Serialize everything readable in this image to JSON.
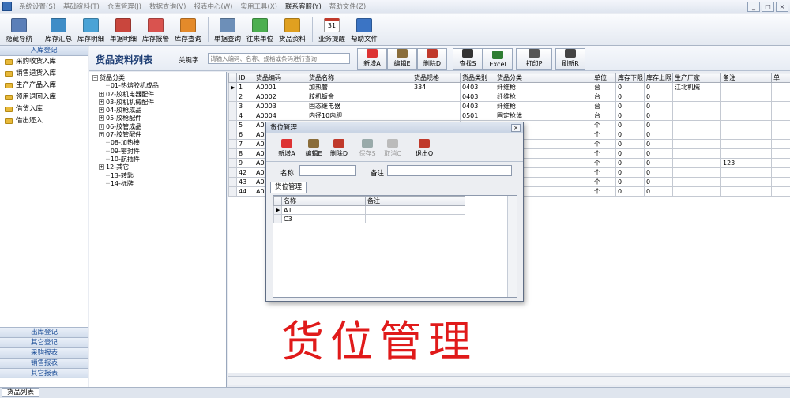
{
  "menu": [
    "系统设置(S)",
    "基础资料(T)",
    "仓库管理(J)",
    "数据查询(V)",
    "报表中心(W)",
    "实用工具(X)",
    "联系客服(Y)",
    "帮助文件(Z)"
  ],
  "window_buttons": [
    "_",
    "□",
    "×"
  ],
  "toolbar": [
    "隐藏导航",
    "库存汇总",
    "库存明细",
    "单据明细",
    "库存报警",
    "库存查询",
    "单据查询",
    "往来单位",
    "货品资料",
    "业务提醒",
    "帮助文件"
  ],
  "calendar_day": "31",
  "left_nav": {
    "header": "入库登记",
    "items": [
      "采购收货入库",
      "销售退货入库",
      "生产产品入库",
      "领用退回入库",
      "借货入库",
      "借出还入"
    ],
    "bottom": [
      "出库登记",
      "其它登记",
      "采购报表",
      "销售报表",
      "其它报表"
    ]
  },
  "page": {
    "title": "货品资料列表",
    "keyword_label": "关键字",
    "keyword_placeholder": "请输入编码、名称、规格或条码进行查询"
  },
  "actions": [
    "新增A",
    "编辑E",
    "删除D",
    "查找S",
    "Excel",
    "打印P",
    "刷新R"
  ],
  "tree": {
    "root": "货品分类",
    "nodes": [
      {
        "label": "01-热熔胶机成品",
        "expand": false
      },
      {
        "label": "02-胶机电器配件",
        "expand": true
      },
      {
        "label": "03-胶机机械配件",
        "expand": true
      },
      {
        "label": "04-胶枪成品",
        "expand": true
      },
      {
        "label": "05-胶枪配件",
        "expand": true
      },
      {
        "label": "06-胶管成品",
        "expand": true
      },
      {
        "label": "07-胶管配件",
        "expand": true
      },
      {
        "label": "08-加热棒",
        "expand": false
      },
      {
        "label": "09-密封件",
        "expand": false
      },
      {
        "label": "10-航插件",
        "expand": false
      },
      {
        "label": "12-其它",
        "expand": true
      },
      {
        "label": "13-转匙",
        "expand": false
      },
      {
        "label": "14-标牌",
        "expand": false
      }
    ]
  },
  "grid": {
    "columns": [
      "ID",
      "货品编码",
      "货品名称",
      "货品规格",
      "货品类别",
      "货品分类",
      "单位",
      "库存下限",
      "库存上限",
      "生产厂家",
      "备注",
      "单"
    ],
    "rows": [
      [
        "1",
        "A0001",
        "加热管",
        "334",
        "0403",
        "纤维枪",
        "台",
        "0",
        "0",
        "江北机械",
        ""
      ],
      [
        "2",
        "A0002",
        "胶机钣金",
        "",
        "0403",
        "纤维枪",
        "台",
        "0",
        "0",
        "",
        ""
      ],
      [
        "3",
        "A0003",
        "固态继电器",
        "",
        "0403",
        "纤维枪",
        "台",
        "0",
        "0",
        "",
        ""
      ],
      [
        "4",
        "A0004",
        "内径10内胆",
        "",
        "0501",
        "固定枪体",
        "台",
        "0",
        "0",
        "",
        ""
      ],
      [
        "5",
        "A0",
        "",
        "",
        "",
        "",
        "个",
        "0",
        "0",
        "",
        ""
      ],
      [
        "6",
        "A0",
        "",
        "",
        "",
        "",
        "个",
        "0",
        "0",
        "",
        ""
      ],
      [
        "7",
        "A0",
        "",
        "",
        "",
        "",
        "个",
        "0",
        "0",
        "",
        ""
      ],
      [
        "8",
        "A0",
        "",
        "",
        "",
        "",
        "个",
        "0",
        "0",
        "",
        ""
      ],
      [
        "9",
        "A0",
        "",
        "",
        "",
        "",
        "个",
        "0",
        "0",
        "",
        "123"
      ],
      [
        "42",
        "A0",
        "",
        "",
        "",
        "",
        "个",
        "0",
        "0",
        "",
        ""
      ],
      [
        "43",
        "A0",
        "",
        "",
        "",
        "",
        "个",
        "0",
        "0",
        "",
        ""
      ],
      [
        "44",
        "A0",
        "",
        "",
        "",
        "",
        "个",
        "0",
        "0",
        "",
        ""
      ]
    ]
  },
  "status_tab": "货品列表",
  "dialog": {
    "title": "货位管理",
    "close": "×",
    "buttons": [
      {
        "label": "新增A",
        "enabled": true
      },
      {
        "label": "编辑E",
        "enabled": true
      },
      {
        "label": "删除D",
        "enabled": true
      },
      {
        "label": "保存S",
        "enabled": false
      },
      {
        "label": "取消C",
        "enabled": false
      },
      {
        "label": "退出Q",
        "enabled": true
      }
    ],
    "name_label": "名称",
    "note_label": "备注",
    "tab": "货位管理",
    "columns": [
      "名称",
      "备注"
    ],
    "rows": [
      [
        "A1",
        ""
      ],
      [
        "C3",
        ""
      ]
    ]
  },
  "overlay_text": "货位管理",
  "colors": {
    "accent": "#1a4c96",
    "overlay": "#e01a1a"
  }
}
